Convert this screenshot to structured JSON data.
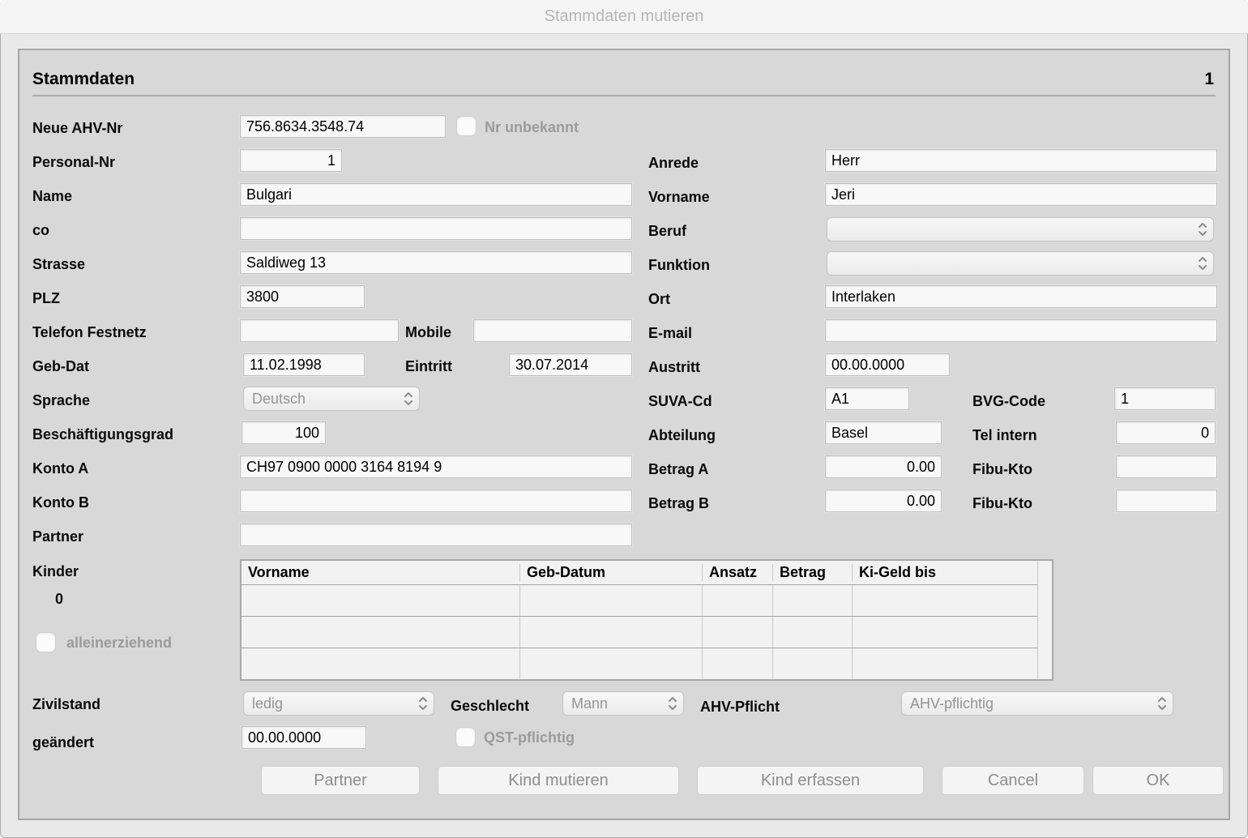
{
  "window": {
    "title": "Stammdaten mutieren"
  },
  "panel": {
    "title": "Stammdaten",
    "record_number": "1"
  },
  "fields": {
    "neue_ahv_nr": {
      "label": "Neue AHV-Nr",
      "value": "756.8634.3548.74"
    },
    "nr_unbekannt": {
      "label": "Nr unbekannt",
      "checked": false
    },
    "personal_nr": {
      "label": "Personal-Nr",
      "value": "1"
    },
    "name": {
      "label": "Name",
      "value": "Bulgari"
    },
    "co": {
      "label": "co",
      "value": ""
    },
    "strasse": {
      "label": "Strasse",
      "value": "Saldiweg 13"
    },
    "plz": {
      "label": "PLZ",
      "value": "3800"
    },
    "telefon_festnetz": {
      "label": "Telefon Festnetz",
      "value": ""
    },
    "mobile": {
      "label": "Mobile",
      "value": ""
    },
    "geb_dat": {
      "label": "Geb-Dat",
      "value": "11.02.1998"
    },
    "eintritt": {
      "label": "Eintritt",
      "value": "30.07.2014"
    },
    "sprache": {
      "label": "Sprache",
      "value": "Deutsch"
    },
    "beschaeftigungsgrad": {
      "label": "Beschäftigungsgrad",
      "value": "100"
    },
    "konto_a": {
      "label": "Konto A",
      "value": "CH97 0900 0000 3164 8194 9"
    },
    "konto_b": {
      "label": "Konto B",
      "value": ""
    },
    "partner": {
      "label": "Partner",
      "value": ""
    },
    "kinder": {
      "label": "Kinder",
      "count": "0"
    },
    "alleinerziehend": {
      "label": "alleinerziehend",
      "checked": false
    },
    "zivilstand": {
      "label": "Zivilstand",
      "value": "ledig"
    },
    "geschlecht": {
      "label": "Geschlecht",
      "value": "Mann"
    },
    "ahv_pflicht": {
      "label": "AHV-Pflicht",
      "value": "AHV-pflichtig"
    },
    "geaendert": {
      "label": "geändert",
      "value": "00.00.0000"
    },
    "qst_pflichtig": {
      "label": "QST-pflichtig",
      "checked": false
    },
    "anrede": {
      "label": "Anrede",
      "value": "Herr"
    },
    "vorname": {
      "label": "Vorname",
      "value": "Jeri"
    },
    "beruf": {
      "label": "Beruf",
      "value": ""
    },
    "funktion": {
      "label": "Funktion",
      "value": ""
    },
    "ort": {
      "label": "Ort",
      "value": "Interlaken"
    },
    "email": {
      "label": "E-mail",
      "value": ""
    },
    "austritt": {
      "label": "Austritt",
      "value": "00.00.0000"
    },
    "suva_cd": {
      "label": "SUVA-Cd",
      "value": "A1"
    },
    "bvg_code": {
      "label": "BVG-Code",
      "value": "1"
    },
    "abteilung": {
      "label": "Abteilung",
      "value": "Basel"
    },
    "tel_intern": {
      "label": "Tel intern",
      "value": "0"
    },
    "betrag_a": {
      "label": "Betrag A",
      "value": "0.00"
    },
    "fibu_kto_a": {
      "label": "Fibu-Kto",
      "value": ""
    },
    "betrag_b": {
      "label": "Betrag B",
      "value": "0.00"
    },
    "fibu_kto_b": {
      "label": "Fibu-Kto",
      "value": ""
    }
  },
  "kinder_table": {
    "headers": [
      "Vorname",
      "Geb-Datum",
      "Ansatz",
      "Betrag",
      "Ki-Geld bis"
    ],
    "rows": [
      [
        "",
        "",
        "",
        "",
        ""
      ],
      [
        "",
        "",
        "",
        "",
        ""
      ],
      [
        "",
        "",
        "",
        "",
        ""
      ]
    ]
  },
  "buttons": {
    "partner": "Partner",
    "kind_mutieren": "Kind mutieren",
    "kind_erfassen": "Kind erfassen",
    "cancel": "Cancel",
    "ok": "OK"
  },
  "colors": {
    "titlebar_bg": "#f5f5f5",
    "window_bg": "#e9e9e9",
    "panel_bg": "#d8d8d8",
    "field_bg": "#f8f8f8",
    "disabled_text": "#9b9b9b"
  }
}
